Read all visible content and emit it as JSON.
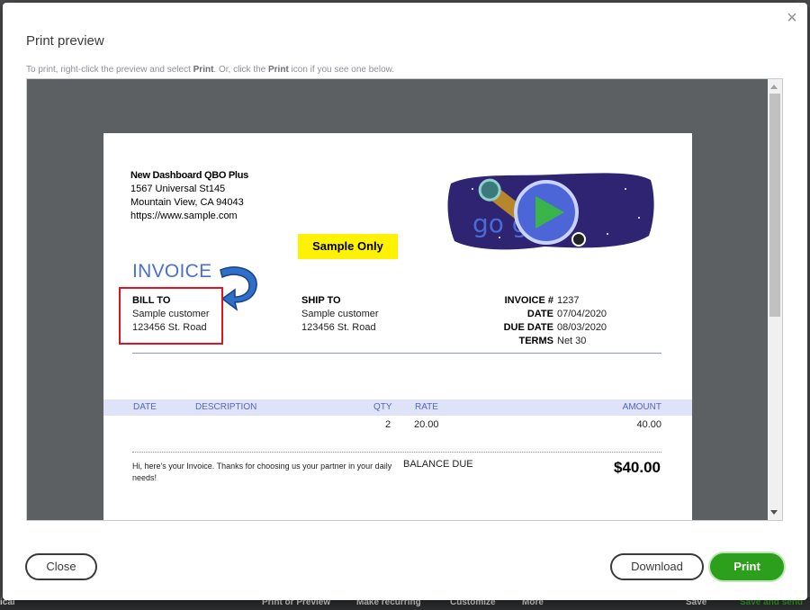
{
  "background": {
    "bottom_bar": {
      "left": "ical",
      "print_preview": "Print or Preview",
      "make_recurring": "Make recurring",
      "customize": "Customize",
      "more": "More",
      "save": "Save",
      "save_and_send": "Save and send"
    }
  },
  "modal": {
    "title": "Print preview",
    "close_glyph": "×",
    "hint_prefix": "To print, right-click the preview and select ",
    "hint_print1": "Print",
    "hint_middle": ". Or, click the ",
    "hint_print2": "Print",
    "hint_suffix": " icon if you see one below."
  },
  "invoice": {
    "company": {
      "name": "New Dashboard QBO Plus",
      "street": "1567 Universal St145",
      "city": "Mountain View, CA  94043",
      "website": "https://www.sample.com"
    },
    "sample_badge": "Sample Only",
    "doodle_letters": "go gle",
    "title": "INVOICE",
    "bill_to": {
      "heading": "BILL TO",
      "name": "Sample customer",
      "address": "123456 St. Road"
    },
    "ship_to": {
      "heading": "SHIP TO",
      "name": "Sample customer",
      "address": "123456 St. Road"
    },
    "meta": [
      {
        "key": "INVOICE #",
        "value": "1237"
      },
      {
        "key": "DATE",
        "value": "07/04/2020"
      },
      {
        "key": "DUE DATE",
        "value": "08/03/2020"
      },
      {
        "key": "TERMS",
        "value": "Net 30"
      }
    ],
    "columns": {
      "date": "DATE",
      "description": "DESCRIPTION",
      "qty": "QTY",
      "rate": "RATE",
      "amount": "AMOUNT"
    },
    "lines": [
      {
        "date": "",
        "description": "",
        "qty": "2",
        "rate": "20.00",
        "amount": "40.00"
      }
    ],
    "message": "Hi, here's your Invoice. Thanks for choosing us your partner in your daily needs!",
    "balance_due_label": "BALANCE DUE",
    "balance_due_value": "$40.00"
  },
  "buttons": {
    "close": "Close",
    "download": "Download",
    "print": "Print"
  },
  "colors": {
    "primary_green": "#2ca01c",
    "invoice_blue": "#4a6fd1",
    "highlight_red": "#e0141e",
    "badge_yellow": "#fff200"
  }
}
